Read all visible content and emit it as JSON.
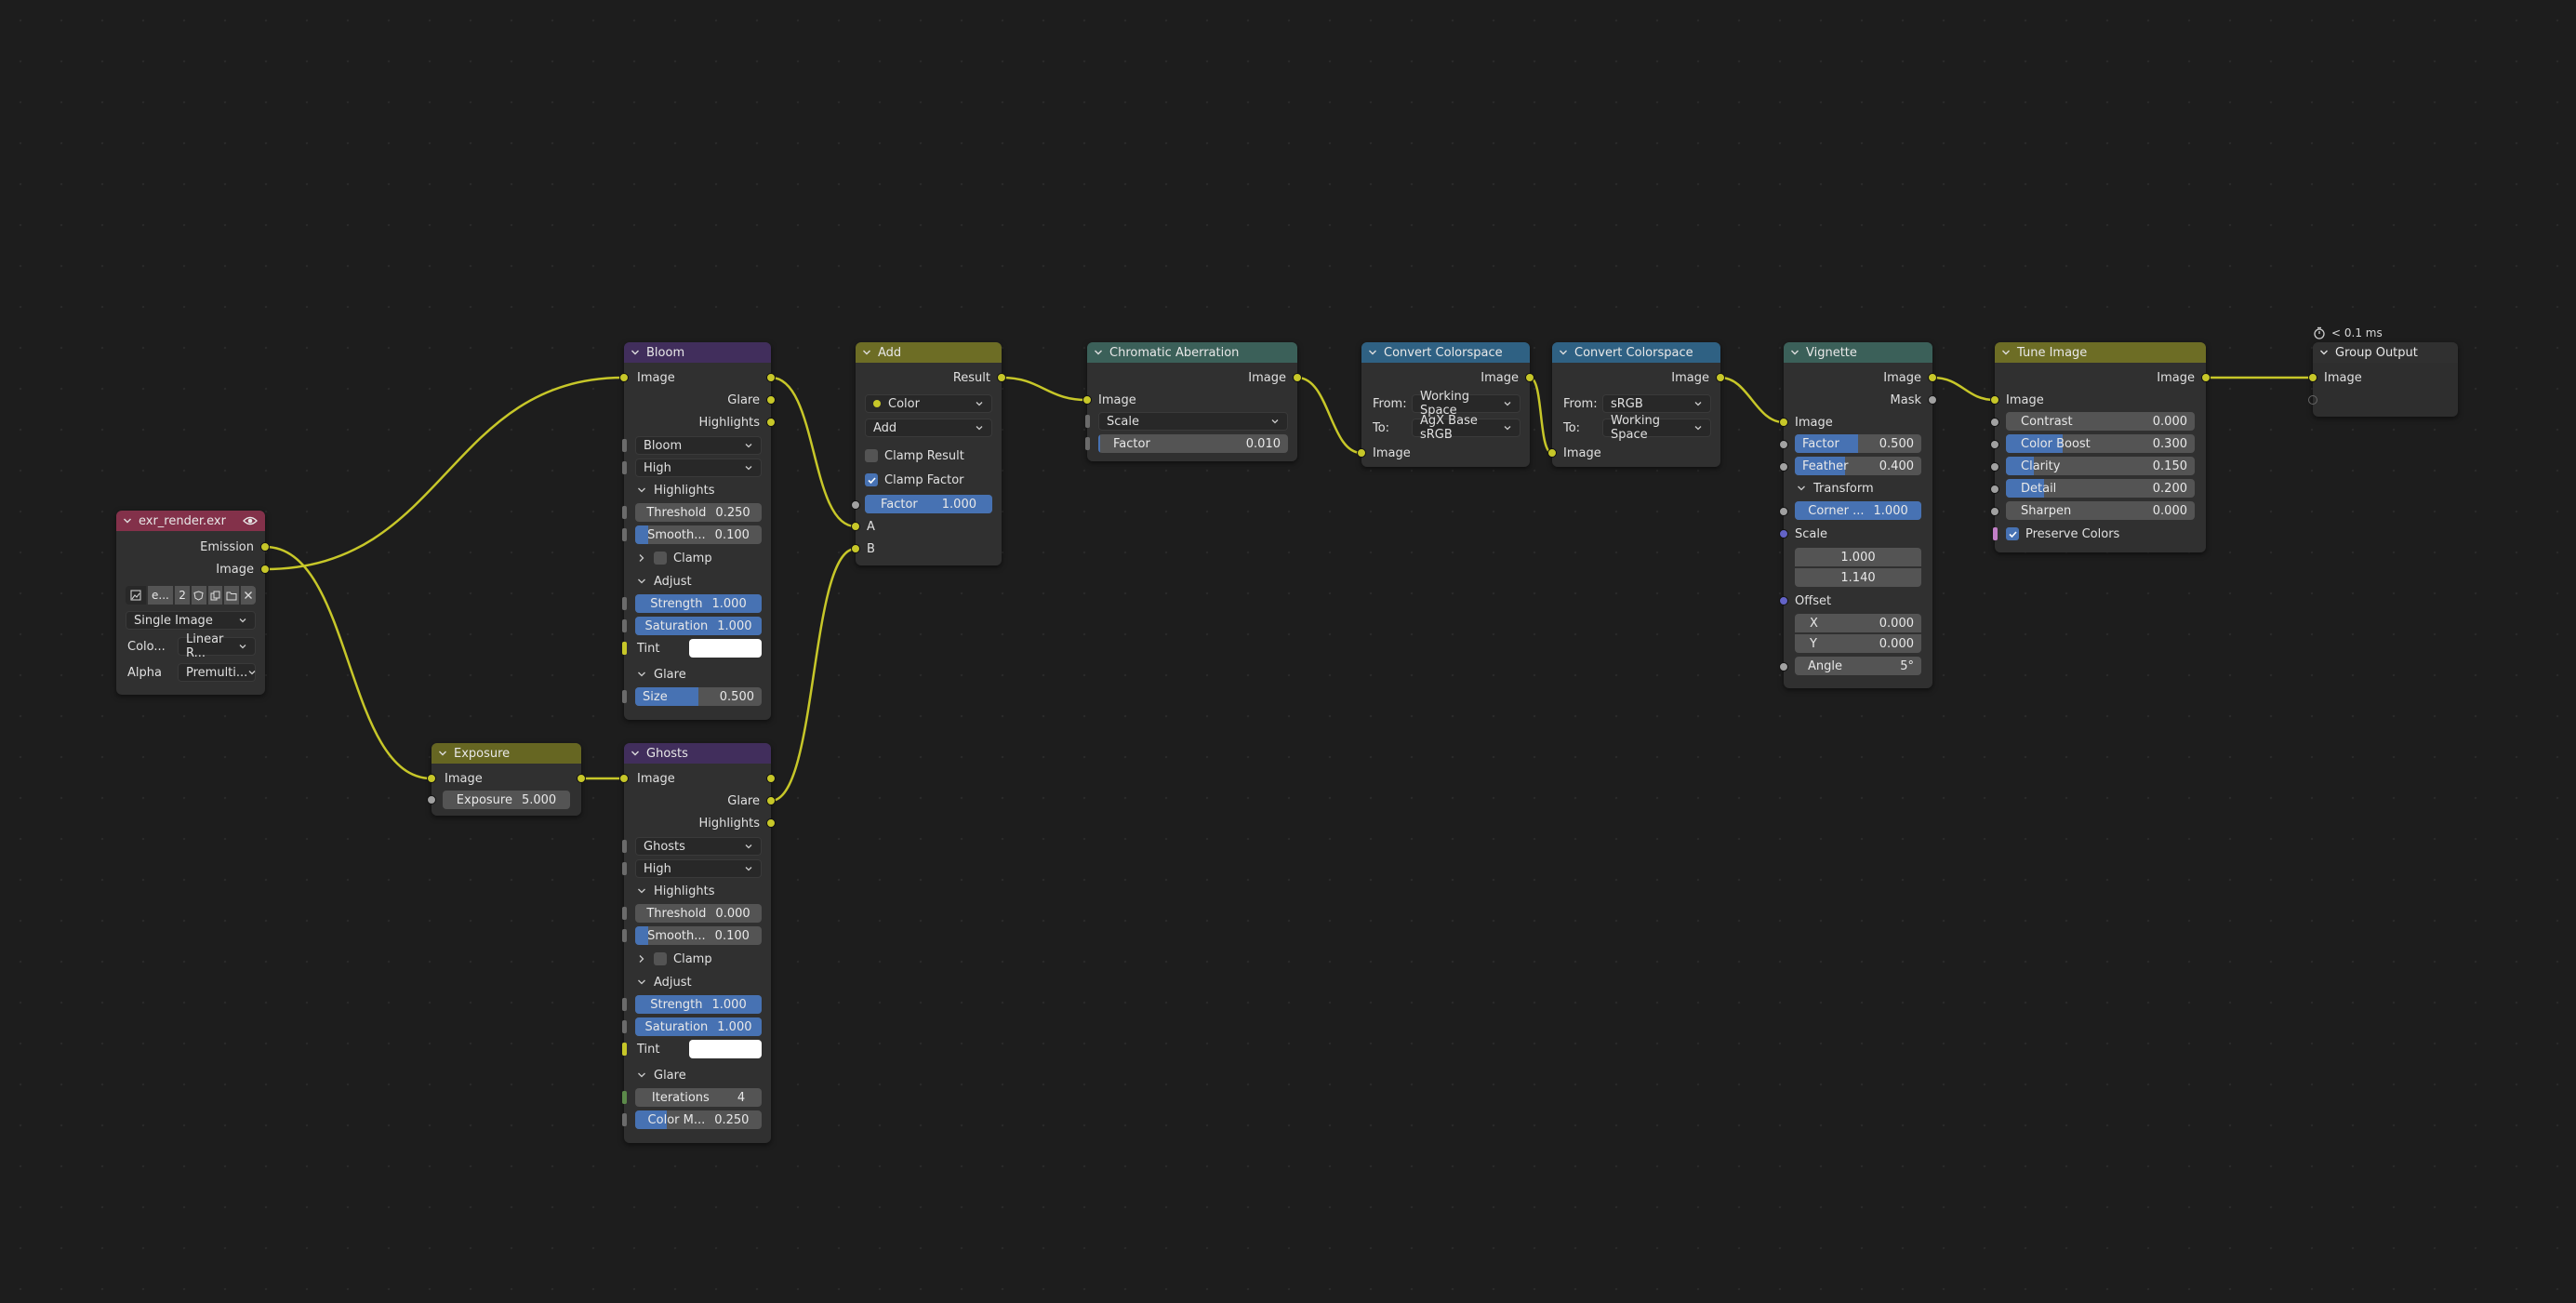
{
  "timer": {
    "label": "< 0.1 ms"
  },
  "colors": {
    "input_header": "#83314a",
    "filter_header": "#412e5c",
    "converter_header": "#666622",
    "color_header": "#6d6d25",
    "distort_header": "#3b6059",
    "vector_header": "#2f6183",
    "output_header": "#303030",
    "wire": "#c7c729"
  },
  "exr": {
    "title": "exr_render.exr",
    "out_emission": "Emission",
    "out_image": "Image",
    "file_short": "e...",
    "users": "2",
    "source": "Single Image",
    "colorspace_label": "Colo...",
    "colorspace_value": "Linear R...",
    "alpha_label": "Alpha",
    "alpha_value": "Premulti..."
  },
  "exposure": {
    "title": "Exposure",
    "in_image": "Image",
    "exposure_label": "Exposure",
    "exposure_value": "5.000"
  },
  "bloom": {
    "title": "Bloom",
    "in_image": "Image",
    "out_glare": "Glare",
    "out_highlights": "Highlights",
    "type": "Bloom",
    "quality": "High",
    "sec_highlights": "Highlights",
    "threshold_label": "Threshold",
    "threshold_value": "0.250",
    "smooth_label": "Smooth...",
    "smooth_value": "0.100",
    "clamp_label": "Clamp",
    "sec_adjust": "Adjust",
    "strength_label": "Strength",
    "strength_value": "1.000",
    "saturation_label": "Saturation",
    "saturation_value": "1.000",
    "tint_label": "Tint",
    "sec_glare": "Glare",
    "size_label": "Size",
    "size_value": "0.500",
    "size_fraction": 0.5
  },
  "ghosts": {
    "title": "Ghosts",
    "in_image": "Image",
    "out_glare": "Glare",
    "out_highlights": "Highlights",
    "type": "Ghosts",
    "quality": "High",
    "sec_highlights": "Highlights",
    "threshold_label": "Threshold",
    "threshold_value": "0.000",
    "smooth_label": "Smooth...",
    "smooth_value": "0.100",
    "clamp_label": "Clamp",
    "sec_adjust": "Adjust",
    "strength_label": "Strength",
    "strength_value": "1.000",
    "saturation_label": "Saturation",
    "saturation_value": "1.000",
    "tint_label": "Tint",
    "sec_glare": "Glare",
    "iterations_label": "Iterations",
    "iterations_value": "4",
    "colormod_label": "Color M...",
    "colormod_value": "0.250"
  },
  "add": {
    "title": "Add",
    "out_result": "Result",
    "type": "Color",
    "blend": "Add",
    "clamp_result_label": "Clamp Result",
    "clamp_factor_label": "Clamp Factor",
    "factor_label": "Factor",
    "factor_value": "1.000",
    "in_a": "A",
    "in_b": "B"
  },
  "chroma": {
    "title": "Chromatic Aberration",
    "out_image": "Image",
    "in_image": "Image",
    "mode": "Scale",
    "factor_label": "Factor",
    "factor_value": "0.010"
  },
  "convert1": {
    "title": "Convert Colorspace",
    "out_image": "Image",
    "from_label": "From:",
    "from_value": "Working Space",
    "to_label": "To:",
    "to_value": "AgX Base sRGB",
    "in_image": "Image"
  },
  "convert2": {
    "title": "Convert Colorspace",
    "out_image": "Image",
    "from_label": "From:",
    "from_value": "sRGB",
    "to_label": "To:",
    "to_value": "Working Space",
    "in_image": "Image"
  },
  "vignette": {
    "title": "Vignette",
    "out_image": "Image",
    "out_mask": "Mask",
    "in_image": "Image",
    "factor_label": "Factor",
    "factor_value": "0.500",
    "factor_fraction": 0.5,
    "feather_label": "Feather",
    "feather_value": "0.400",
    "feather_fraction": 0.4,
    "sec_transform": "Transform",
    "corner_label": "Corner ...",
    "corner_value": "1.000",
    "scale_label": "Scale",
    "scale_x": "1.000",
    "scale_y": "1.140",
    "offset_label": "Offset",
    "x_label": "X",
    "x_value": "0.000",
    "y_label": "Y",
    "y_value": "0.000",
    "angle_label": "Angle",
    "angle_value": "5°"
  },
  "tune": {
    "title": "Tune Image",
    "out_image": "Image",
    "in_image": "Image",
    "contrast_label": "Contrast",
    "contrast_value": "0.000",
    "colorboost_label": "Color Boost",
    "colorboost_value": "0.300",
    "colorboost_fraction": 0.3,
    "clarity_label": "Clarity",
    "clarity_value": "0.150",
    "clarity_fraction": 0.15,
    "detail_label": "Detail",
    "detail_value": "0.200",
    "detail_fraction": 0.2,
    "sharpen_label": "Sharpen",
    "sharpen_value": "0.000",
    "preserve_label": "Preserve Colors"
  },
  "group_output": {
    "title": "Group Output",
    "in_image": "Image"
  }
}
